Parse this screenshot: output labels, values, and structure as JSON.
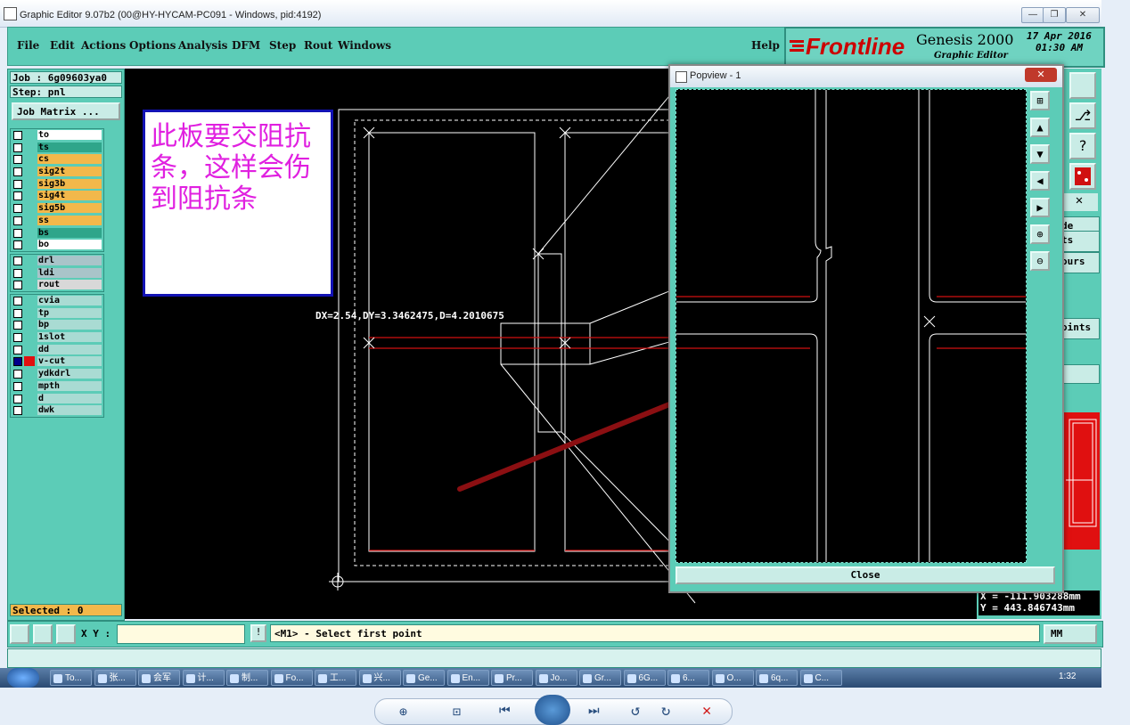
{
  "window": {
    "title": "Graphic Editor 9.07b2 (00@HY-HYCAM-PC091 - Windows, pid:4192)",
    "controls": [
      "—",
      "❐",
      "✕"
    ]
  },
  "menu": {
    "items": [
      "File",
      "Edit",
      "Actions",
      "Options",
      "Analysis",
      "DFM",
      "Step",
      "Rout",
      "Windows"
    ],
    "help": "Help"
  },
  "brand": {
    "logo": "Frontline",
    "product": "Genesis 2000",
    "subtitle": "Graphic Editor",
    "date": "17 Apr 2016",
    "time": "01:30 AM"
  },
  "job": {
    "job_label": "Job : 6g09603ya0",
    "step_label": "Step: pnl",
    "matrix_button": "Job Matrix ..."
  },
  "layers": {
    "group1": [
      {
        "name": "to",
        "color": "#ffffff"
      },
      {
        "name": "ts",
        "color": "#2fa58a"
      },
      {
        "name": "cs",
        "color": "#f2b84b"
      },
      {
        "name": "sig2t",
        "color": "#f2b84b"
      },
      {
        "name": "sig3b",
        "color": "#f2b84b"
      },
      {
        "name": "sig4t",
        "color": "#f2b84b"
      },
      {
        "name": "sig5b",
        "color": "#f2b84b"
      },
      {
        "name": "ss",
        "color": "#f2b84b"
      },
      {
        "name": "bs",
        "color": "#2fa58a"
      },
      {
        "name": "bo",
        "color": "#ffffff"
      }
    ],
    "group2": [
      {
        "name": "drl",
        "color": "#a9c4c9"
      },
      {
        "name": "ldi",
        "color": "#a9c4c9"
      },
      {
        "name": "rout",
        "color": "#d8d8d8"
      }
    ],
    "group3": [
      {
        "name": "cvia",
        "color": "#a9dbd3"
      },
      {
        "name": "tp",
        "color": "#a9dbd3"
      },
      {
        "name": "bp",
        "color": "#a9dbd3"
      },
      {
        "name": "1slot",
        "color": "#a9dbd3"
      },
      {
        "name": "dd",
        "color": "#a9dbd3"
      },
      {
        "name": "v-cut",
        "color": "#a9dbd3",
        "active": true
      },
      {
        "name": "ydkdrl",
        "color": "#a9dbd3"
      },
      {
        "name": "mpth",
        "color": "#a9dbd3"
      },
      {
        "name": "d",
        "color": "#a9dbd3"
      },
      {
        "name": "dwk",
        "color": "#a9dbd3"
      }
    ]
  },
  "selected": "Selected : 0",
  "note": {
    "text": "此板要交阻抗条，这样会伤到阻抗条"
  },
  "measure": {
    "text": "DX=2.54,DY=3.3462475,D=4.2010675"
  },
  "popup": {
    "title": "Popview - 1",
    "close": "Close"
  },
  "right_panel": {
    "labels": [
      "de",
      "ts",
      "ours",
      "oints"
    ]
  },
  "coords": {
    "x": "X = -111.903288mm",
    "y": "Y = 443.846743mm"
  },
  "bottom": {
    "xy_label": "X Y :",
    "xy_value": "",
    "prompt": "<M1> - Select first point",
    "units": "MM"
  },
  "taskbar": {
    "items": [
      "To...",
      "张...",
      "会军",
      "计...",
      "制...",
      "Fo...",
      "工...",
      "兴...",
      "Ge...",
      "En...",
      "Pr...",
      "Jo...",
      "Gr...",
      "6G...",
      "6...",
      "O...",
      "6q...",
      "C..."
    ],
    "time": "1:32"
  },
  "colors": {
    "teal": "#5cccb7",
    "canvas": "#000000",
    "accent_red": "#cc1010",
    "note_text": "#e020e0"
  }
}
